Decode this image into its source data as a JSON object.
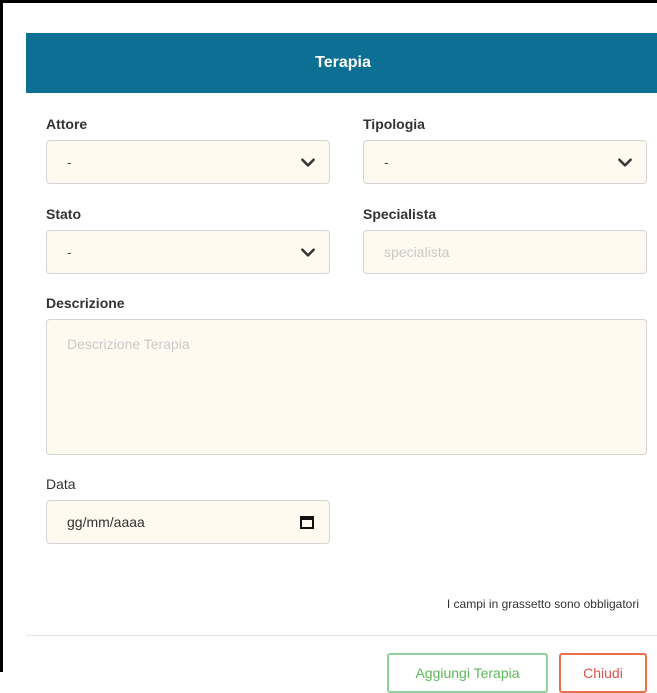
{
  "modal": {
    "title": "Terapia",
    "note": "I campi in grassetto sono obbligatori"
  },
  "form": {
    "attore": {
      "label": "Attore",
      "value": "-"
    },
    "tipologia": {
      "label": "Tipologia",
      "value": "-"
    },
    "stato": {
      "label": "Stato",
      "value": "-"
    },
    "specialista": {
      "label": "Specialista",
      "placeholder": "specialista"
    },
    "descrizione": {
      "label": "Descrizione",
      "placeholder": "Descrizione Terapia"
    },
    "data": {
      "label": "Data",
      "value": "gg/mm/aaaa"
    }
  },
  "buttons": {
    "add_label": "Aggiungi Terapia",
    "close_label": "Chiudi"
  },
  "colors": {
    "header": "#0d6f93",
    "field_bg": "#fffaf0",
    "add_border": "#8fd19e",
    "close_border": "#e8704a"
  },
  "icons": {
    "select": "chevron-down-icon",
    "date": "calendar-icon"
  }
}
